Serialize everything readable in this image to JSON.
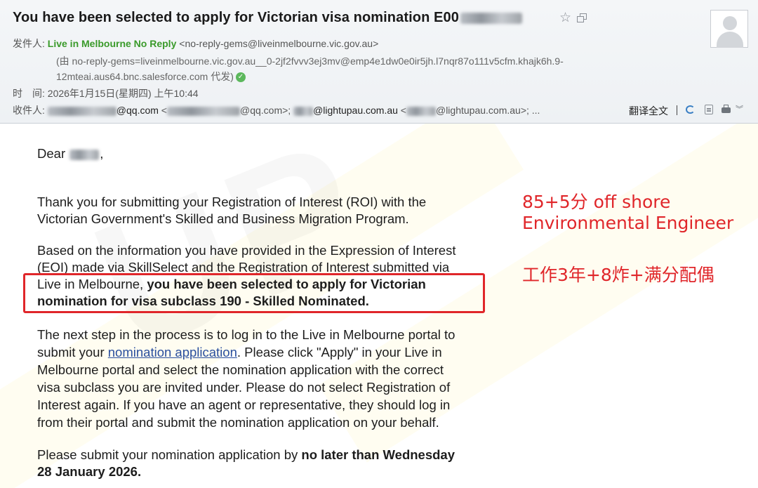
{
  "email": {
    "subject": "You have been selected to apply for Victorian visa nomination E00",
    "icons": {
      "star": "star-icon",
      "popout": "popout-window-icon",
      "avatar": "user-avatar",
      "verified": "check-circle-icon",
      "reply": "reply-icon",
      "note": "note-icon",
      "print": "print-icon",
      "more": "chevron-down-icon"
    },
    "from": {
      "label": "发件人:",
      "name": "Live in Melbourne No Reply",
      "address": "<no-reply-gems@liveinmelbourne.vic.gov.au>",
      "relay_line1": "(由 no-reply-gems=liveinmelbourne.vic.gov.au__0-2jf2fvvv3ej3mv@emp4e1dw0e0ir5jh.l7nqr87o111v5cfm.khajk6h.9-",
      "relay_line2": "12mteai.aus64.bnc.salesforce.com 代发)",
      "verified_glyph": "✓"
    },
    "time": {
      "label": "时　间:",
      "value": "2026年1月15日(星期四) 上午10:44"
    },
    "to": {
      "label": "收件人:",
      "addr1_domain": "@qq.com",
      "addr1_full_prefix": " <",
      "addr1_full_suffix": "@qq.com>; ",
      "addr2_domain": "@lightupau.com.au",
      "addr2_full_prefix": " <",
      "addr2_full_suffix": "@lightupau.com.au>; ..."
    },
    "actions": {
      "translate": "翻译全文",
      "more_glyph": "︾"
    }
  },
  "body": {
    "greeting_prefix": "Dear ",
    "greeting_suffix": ",",
    "p1_line1": "Thank you for submitting your Registration of Interest (ROI) with the",
    "p1_line2": "Victorian Government's Skilled and Business Migration Program.",
    "p2_line1": "Based on the information you have provided in the Expression of Interest",
    "p2_line2": "(EOI) made via SkillSelect and the Registration of Interest submitted via",
    "p2_line3_normal": "Live in Melbourne, ",
    "p2_line3_bold": "you have been selected to apply for Victorian",
    "p2_line4_bold": "nomination for visa subclass 190 - Skilled Nominated.",
    "p3_line1": "The next step in the process is to log in to the Live in Melbourne portal to",
    "p3_line2_before": "submit your ",
    "p3_link": "nomination application",
    "p3_line2_after": ". Please click \"Apply\" in your Live in",
    "p3_line3": "Melbourne portal and select the nomination application with the correct",
    "p3_line4": "visa subclass you are invited under. Please do not select Registration of",
    "p3_line5": "Interest again. If you have an agent or representative, they should log in",
    "p3_line6": "from their portal and submit the nomination application on your behalf.",
    "p4_line1_normal": "Please submit your nomination application by ",
    "p4_line1_bold": "no later than Wednesday",
    "p4_line2_bold": "28 January 2026."
  },
  "annotation": {
    "line1": "85+5分 off shore",
    "line2": "Environmental Engineer",
    "line3": "工作3年+8炸+满分配偶"
  },
  "colors": {
    "accent_red": "#e0262a",
    "sender_green": "#3a9a2a",
    "link_blue": "#2a4f9e"
  }
}
